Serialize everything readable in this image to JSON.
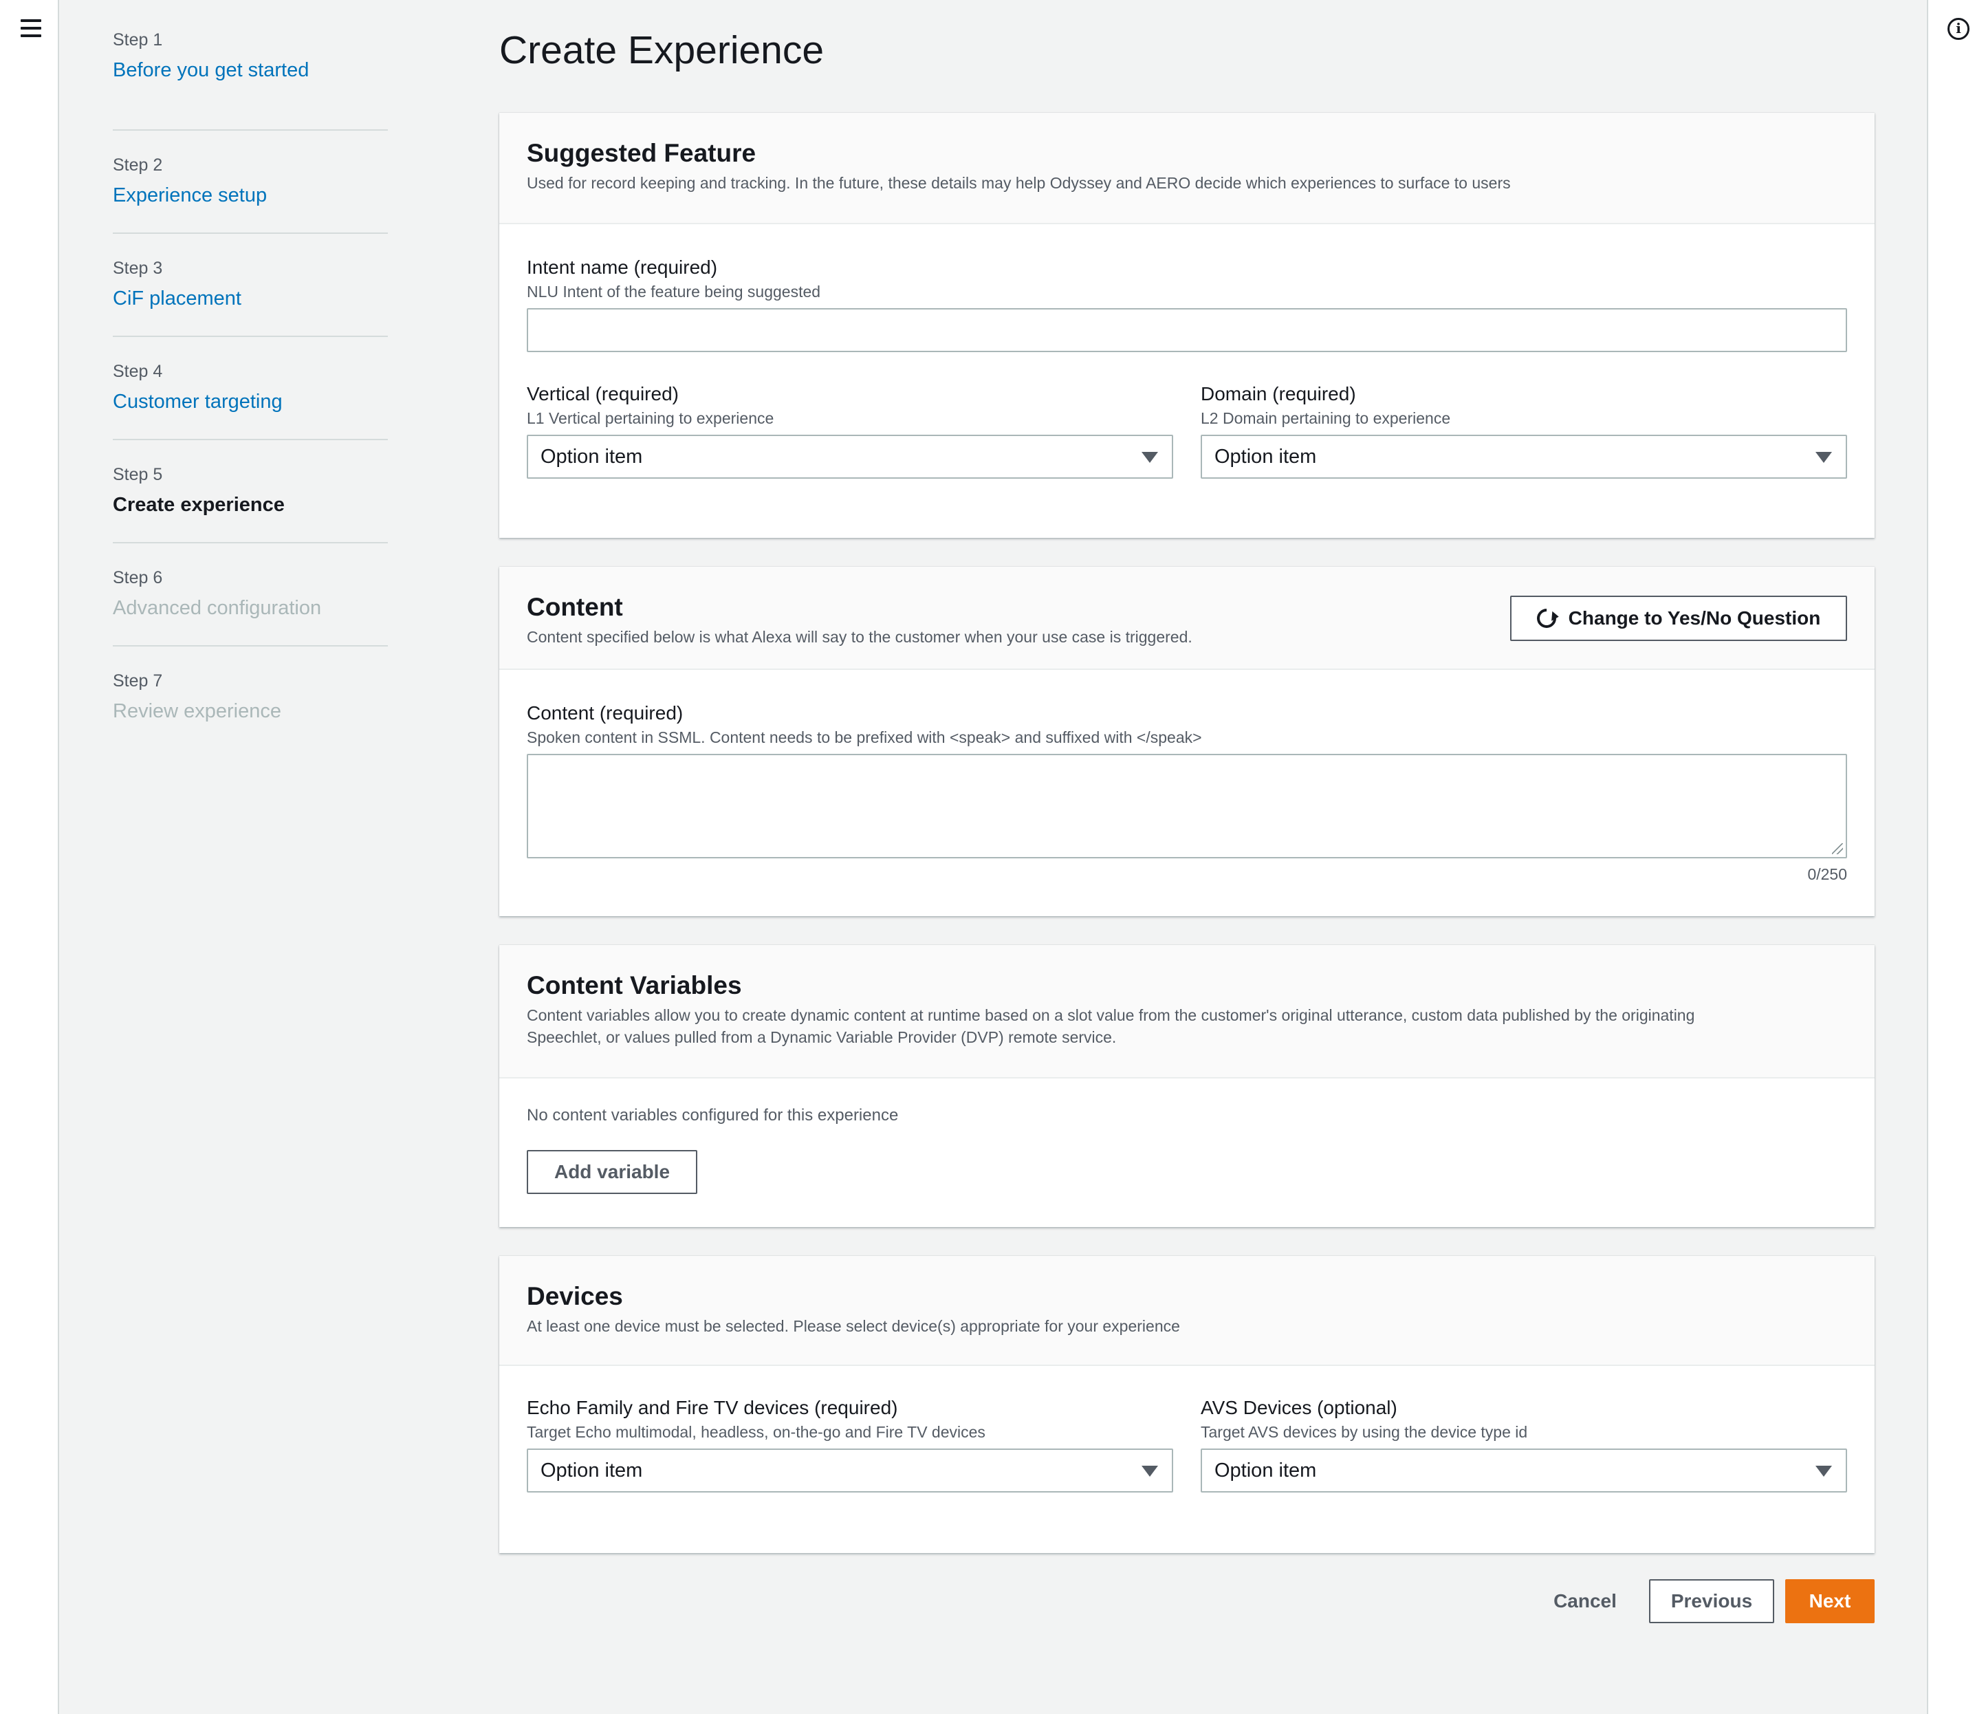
{
  "app": {
    "menu_icon": "hamburger-menu-icon",
    "info_icon": "info-icon"
  },
  "steps": [
    {
      "num": "Step 1",
      "title": "Before you get started",
      "state": "link"
    },
    {
      "num": "Step 2",
      "title": "Experience setup",
      "state": "link"
    },
    {
      "num": "Step 3",
      "title": "CiF placement",
      "state": "link"
    },
    {
      "num": "Step 4",
      "title": "Customer targeting",
      "state": "link"
    },
    {
      "num": "Step 5",
      "title": "Create experience",
      "state": "active"
    },
    {
      "num": "Step 6",
      "title": "Advanced configuration",
      "state": "disabled"
    },
    {
      "num": "Step 7",
      "title": "Review experience",
      "state": "disabled"
    }
  ],
  "page_title": "Create Experience",
  "suggested_feature": {
    "title": "Suggested Feature",
    "description": "Used for record keeping and tracking. In the future, these details may help Odyssey and AERO decide which experiences to surface to users",
    "intent": {
      "label": "Intent name (required)",
      "desc": "NLU Intent of the feature being suggested",
      "value": ""
    },
    "vertical": {
      "label": "Vertical (required)",
      "desc": "L1 Vertical pertaining to experience",
      "value": "Option item"
    },
    "domain": {
      "label": "Domain (required)",
      "desc": "L2 Domain pertaining to experience",
      "value": "Option item"
    }
  },
  "content": {
    "title": "Content",
    "description": "Content specified below is what Alexa will say to the customer when your use case is triggered.",
    "change_button": "Change to Yes/No Question",
    "field": {
      "label": "Content (required)",
      "desc": "Spoken content in SSML. Content needs to be prefixed with <speak> and suffixed with </speak>",
      "value": ""
    },
    "counter": "0/250"
  },
  "content_variables": {
    "title": "Content Variables",
    "description_line1": "Content variables allow you to create dynamic content at runtime based on a slot value from the customer's original utterance, custom data published by the originating",
    "description_line2": "Speechlet, or values pulled from a Dynamic Variable Provider (DVP) remote service.",
    "empty_text": "No content variables configured for this experience",
    "add_button": "Add variable"
  },
  "devices": {
    "title": "Devices",
    "description": "At least one device must be selected. Please select device(s) appropriate for your experience",
    "echo": {
      "label": "Echo Family and Fire TV devices (required)",
      "desc": "Target Echo multimodal, headless, on-the-go and Fire TV devices",
      "value": "Option item"
    },
    "avs": {
      "label": "AVS Devices (optional)",
      "desc": "Target AVS devices by using the device type id",
      "value": "Option item"
    }
  },
  "footer": {
    "cancel": "Cancel",
    "previous": "Previous",
    "next": "Next"
  },
  "colors": {
    "link": "#0073bb",
    "primary": "#ec7211",
    "background": "#f2f3f3"
  }
}
